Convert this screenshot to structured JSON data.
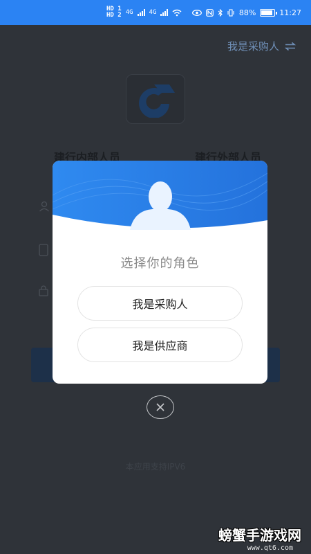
{
  "status_bar": {
    "hd1": "HD 1",
    "hd2": "HD 2",
    "net1": "4G",
    "net2": "4G",
    "battery_percent": "88%",
    "time": "11:27"
  },
  "background": {
    "role_switch_label": "我是采购人",
    "role_switch_icon": "swap-icon",
    "tab_internal": "建行内部人员",
    "tab_external": "建行外部人员",
    "ipv6_note": "本应用支持IPV6",
    "colors": {
      "logo": "#1d3d66",
      "login_button": "#1d3049"
    }
  },
  "modal": {
    "title": "选择你的角色",
    "buyer_label": "我是采购人",
    "supplier_label": "我是供应商",
    "header_color": "#2b7ee8"
  },
  "watermark": {
    "text": "螃蟹手游戏网",
    "url": "www.qt6.com"
  }
}
